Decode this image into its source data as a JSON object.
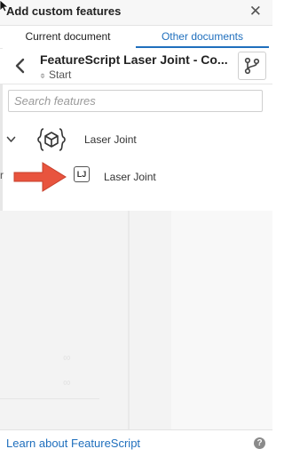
{
  "dialog": {
    "title": "Add custom features",
    "close_glyph": "✕"
  },
  "tabs": [
    {
      "label": "Current document",
      "active": false
    },
    {
      "label": "Other documents",
      "active": true
    }
  ],
  "document": {
    "title": "FeatureScript Laser Joint - Co...",
    "version_glyph": "⌽",
    "version": "Start"
  },
  "search": {
    "placeholder": "Search features",
    "value": ""
  },
  "tree": {
    "studio": {
      "label": "Laser Joint",
      "icon": "feature-studio-icon",
      "expanded": true
    },
    "features": [
      {
        "label": "Laser Joint",
        "icon_text": "LJ"
      }
    ]
  },
  "footer": {
    "link": "Learn about FeatureScript",
    "help_glyph": "?"
  },
  "colors": {
    "accent": "#1f6fbd",
    "annotation_arrow": "#e8543e"
  }
}
